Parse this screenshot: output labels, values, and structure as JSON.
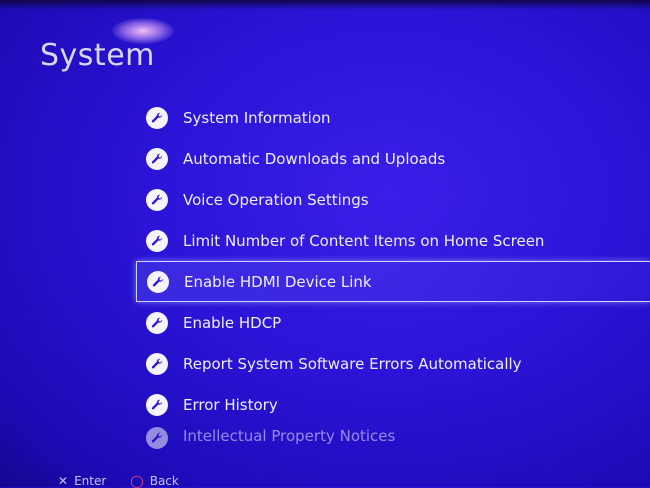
{
  "page": {
    "title": "System"
  },
  "menu": {
    "items": [
      {
        "label": "System Information",
        "icon": "wrench-icon"
      },
      {
        "label": "Automatic Downloads and Uploads",
        "icon": "wrench-icon"
      },
      {
        "label": "Voice Operation Settings",
        "icon": "wrench-icon"
      },
      {
        "label": "Limit Number of Content Items on Home Screen",
        "icon": "wrench-icon"
      },
      {
        "label": "Enable HDMI Device Link",
        "icon": "wrench-icon",
        "selected": true
      },
      {
        "label": "Enable HDCP",
        "icon": "wrench-icon"
      },
      {
        "label": "Report System Software Errors Automatically",
        "icon": "wrench-icon"
      },
      {
        "label": "Error History",
        "icon": "wrench-icon"
      },
      {
        "label": "Intellectual Property Notices",
        "icon": "wrench-icon"
      }
    ]
  },
  "footer": {
    "enter_label": "Enter",
    "back_label": "Back",
    "enter_icon": "cross-button-icon",
    "back_icon": "circle-button-icon"
  },
  "colors": {
    "background": "#2a14d6",
    "selection_border": "#cfd2ff",
    "circle_button": "#ff4b72"
  }
}
